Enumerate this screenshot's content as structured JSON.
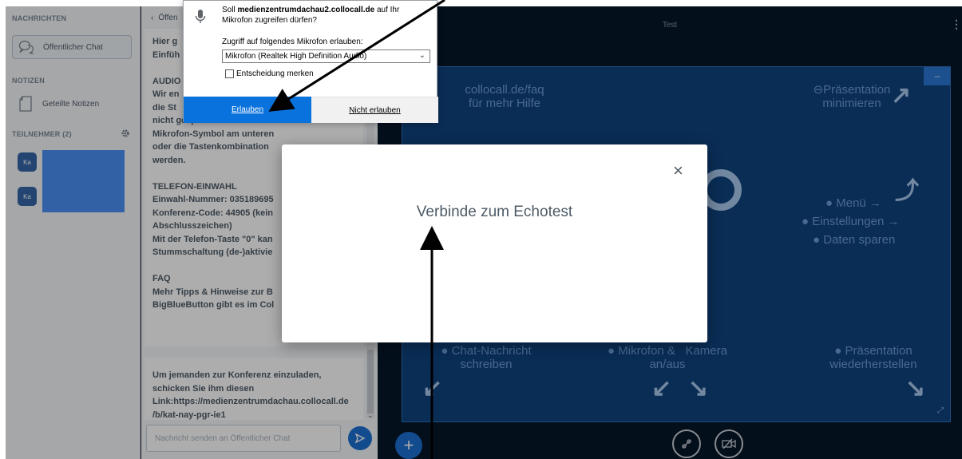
{
  "userlist": {
    "messages_title": "NACHRICHTEN",
    "public_chat": "Öffentlicher Chat",
    "notes_title": "NOTIZEN",
    "shared_notes": "Geteilte Notizen",
    "participants_title": "TEILNEHMER (2)",
    "participants": [
      {
        "initials": "Ka"
      },
      {
        "initials": "Ka"
      }
    ]
  },
  "chat": {
    "header": "Öffen",
    "messages": [
      "Hier g\nEinfüh\n\nAUDIO\nWir en\ndie St\nnicht gesprochen wird. Dafür kann das\nMikrofon-Symbol am unteren\noder die Tastenkombination\nwerden.\n\nTELEFON-EINWAHL\nEinwahl-Nummer: 035189695\nKonferenz-Code: 44905 (kein\nAbschlusszeichen)\nMit der Telefon-Taste \"0\" kan\nStummschaltung (de-)aktivie\n\nFAQ\nMehr Tipps & Hinweise zur B\nBigBlueButton gibt es im Col",
      "Um jemanden zur Konferenz einzuladen,\nschicken Sie ihm diesen\nLink:https://medienzentrumdachau.collocall.de\n/b/kat-nay-pgr-ie1"
    ],
    "input_placeholder": "Nachricht senden an Öffentlicher Chat"
  },
  "main": {
    "title": "Test",
    "slide": {
      "help_text": "collocall.de/faq\nfür mehr Hilfe",
      "minimize_text": "Präsentation\nminimieren",
      "menu_text": "Menü →",
      "settings_text": "Einstellungen →",
      "data_saving_text": "Daten sparen",
      "chat_text": "Chat-Nachricht\nschreiben",
      "mic_cam_text": "Mikrofon &   Kamera\nan/aus",
      "restore_text": "Präsentation\nwiederherstellen",
      "minimize_button": "–"
    }
  },
  "modal": {
    "text": "Verbinde zum Echotest",
    "close": "×"
  },
  "permission": {
    "question_prefix": "Soll ",
    "domain": "medienzentrumdachau2.collocall.de",
    "question_suffix": " auf Ihr Mikrofon zugreifen dürfen?",
    "select_label": "Zugriff auf folgendes Mikrofon erlauben:",
    "selected_device": "Mikrofon (Realtek High Definition Audio)",
    "remember": "Entscheidung merken",
    "allow": "Erlauben",
    "deny": "Nicht erlauben"
  },
  "colors": {
    "accent": "#0a72dc",
    "slide_bg": "#0f437f",
    "panel_bg": "#f3f6f9"
  }
}
